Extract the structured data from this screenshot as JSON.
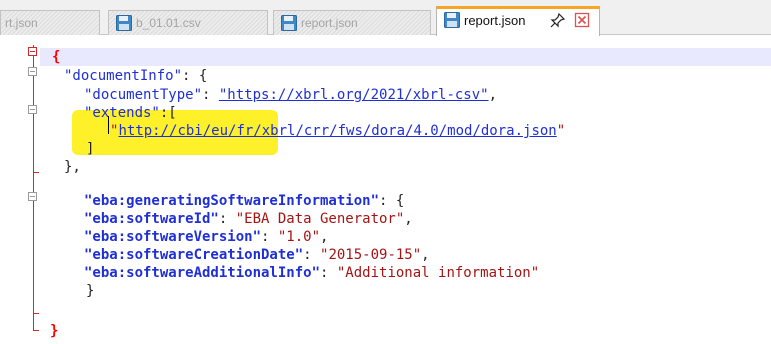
{
  "tabs": [
    {
      "label": "rt.json",
      "active": false
    },
    {
      "label": "b_01.01.csv",
      "active": false
    },
    {
      "label": "report.json",
      "active": false
    },
    {
      "label": "report.json",
      "active": true
    }
  ],
  "icons": {
    "file": "floppy-disk-icon",
    "pin": "pin-icon",
    "close": "close-icon"
  },
  "colors": {
    "key": "#1f2fd6",
    "string": "#a31515",
    "fold": "#d22a2a",
    "highlight": "#fff129",
    "active_tab_accent": "#f6a524"
  },
  "code": {
    "l1_brace": "{",
    "l2_key": "\"documentInfo\"",
    "l2_rest": ": {",
    "l3_key": "\"documentType\"",
    "l3_colon": ": ",
    "l3_value": "\"https://xbrl.org/2021/xbrl-csv\"",
    "l3_comma": ",",
    "l4_key": "\"extends\"",
    "l4_rest": ":[",
    "l5_open_quote": "\"",
    "l5_value": "http://cbi/eu/fr/xbrl/crr/fws/dora/4.0/mod/dora.json",
    "l5_close_quote": "\"",
    "l6": "]",
    "l7": "},",
    "l8_key": "\"eba:generatingSoftwareInformation\"",
    "l8_rest": ": {",
    "l9_key": "\"eba:softwareId\"",
    "l9_colon": ": ",
    "l9_value": "\"EBA Data Generator\"",
    "l9_comma": ",",
    "l10_key": "\"eba:softwareVersion\"",
    "l10_colon": ": ",
    "l10_value": "\"1.0\"",
    "l10_comma": ",",
    "l11_key": "\"eba:softwareCreationDate\"",
    "l11_colon": ": ",
    "l11_value": "\"2015-09-15\"",
    "l11_comma": ",",
    "l12_key": "\"eba:softwareAdditionalInfo\"",
    "l12_colon": ": ",
    "l12_value": "\"Additional information\"",
    "l13": "}",
    "l14_brace": "}"
  }
}
